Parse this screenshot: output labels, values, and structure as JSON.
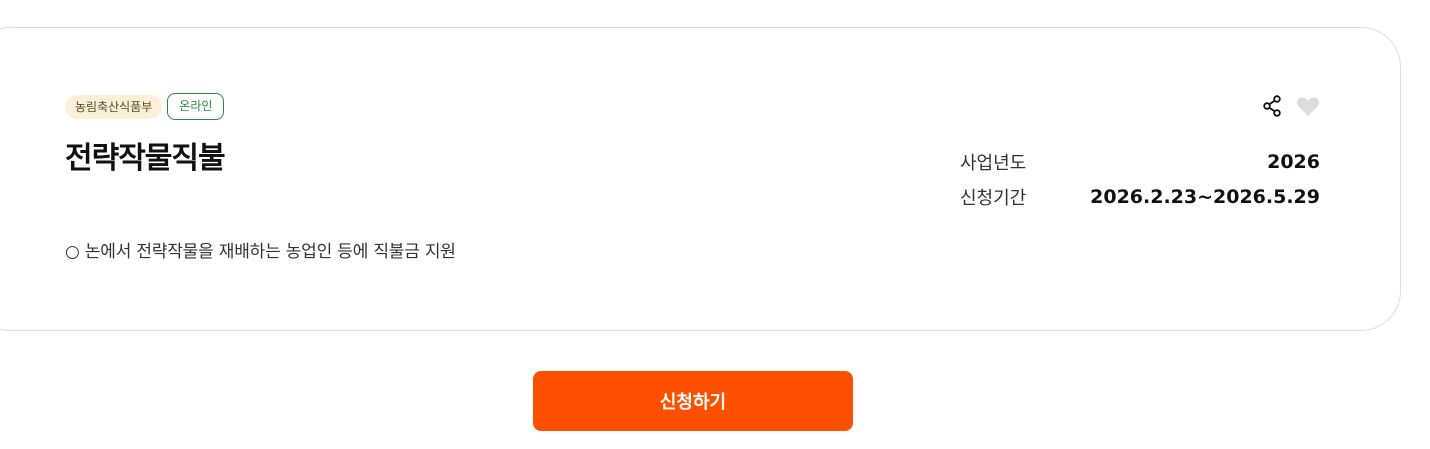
{
  "card": {
    "ministry_tag": "농림축산식품부",
    "channel_tag": "온라인",
    "title": "전략작물직불",
    "description": "○ 논에서 전략작물을 재배하는 농업인 등에 직불금 지원",
    "info": [
      {
        "label": "사업년도",
        "value": "2026"
      },
      {
        "label": "신청기간",
        "value": "2026.2.23~2026.5.29"
      }
    ],
    "icons": {
      "share": "share-icon",
      "like": "heart-icon"
    }
  },
  "apply_button_label": "신청하기",
  "colors": {
    "accent": "#fe5000",
    "ministry_tag_bg": "#fdf0d9",
    "online_tag": "#2b8a3e",
    "heart": "#dddddd",
    "card_border": "#dedede"
  }
}
